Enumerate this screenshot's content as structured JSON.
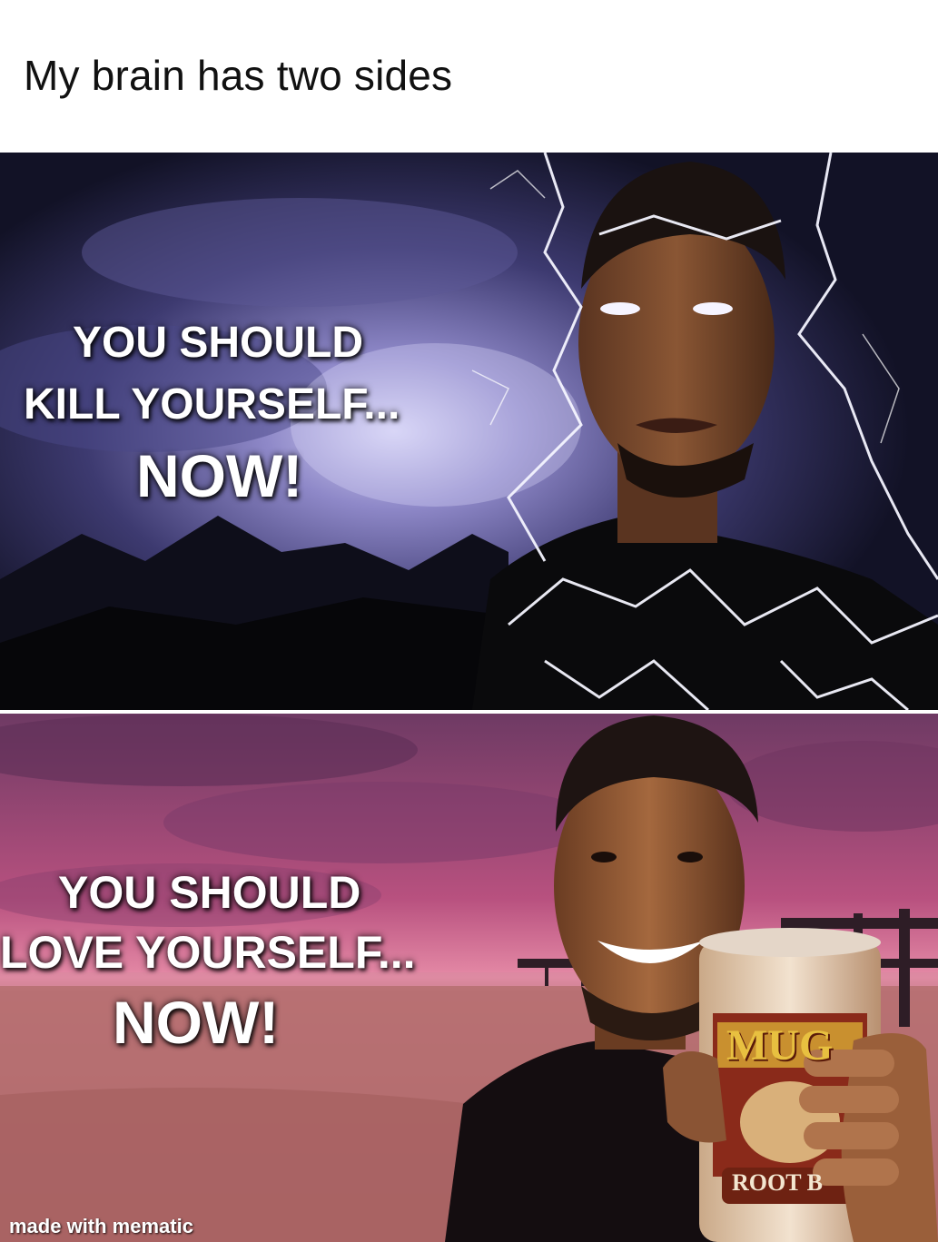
{
  "caption": "My brain has two sides",
  "top_panel": {
    "line1": "YOU SHOULD",
    "line2": "KILL YOURSELF...",
    "line3": "NOW!"
  },
  "bottom_panel": {
    "line1": "YOU SHOULD",
    "line2": "LOVE YOURSELF...",
    "line3": "NOW!",
    "can_brand": "MUG",
    "can_label": "ROOT B"
  },
  "watermark": "made with mematic",
  "colors": {
    "storm_sky": "#3b3a6e",
    "lightning": "#f4f4ff",
    "sunset_sky": "#b8517f",
    "beach": "#c47a7a",
    "can": "#8a2a1a"
  }
}
